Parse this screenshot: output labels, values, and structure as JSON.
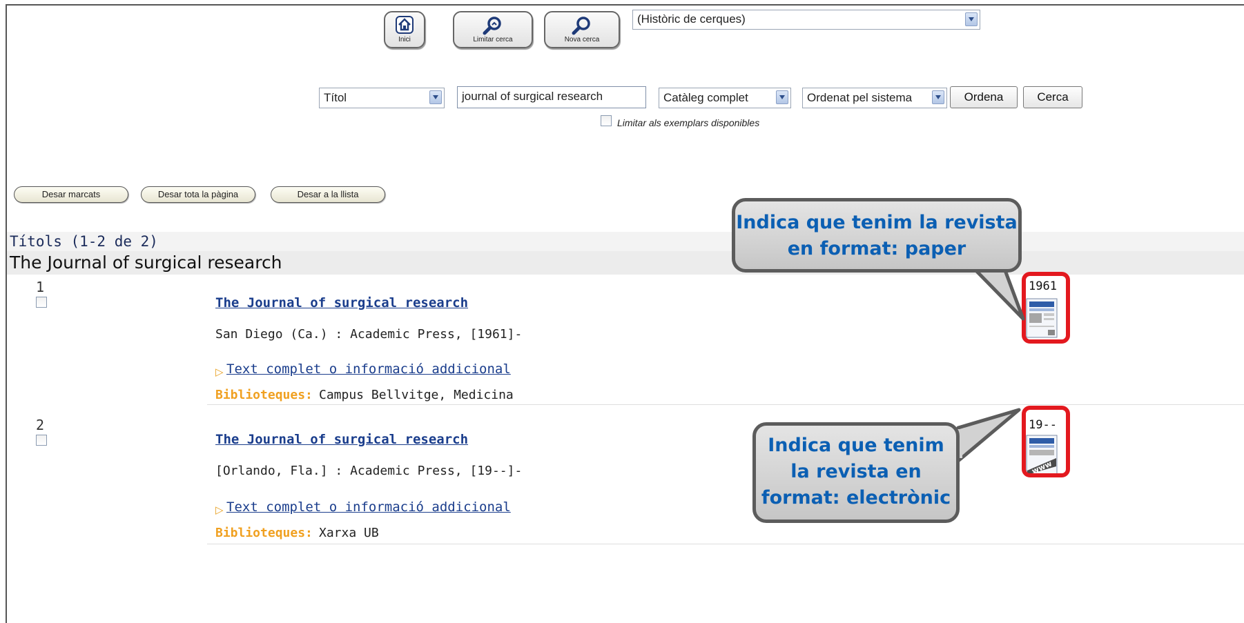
{
  "toolbar": {
    "home_label": "Inici",
    "limit_label": "Limitar cerca",
    "new_label": "Nova cerca",
    "history_select": "(Històric de cerques)"
  },
  "search": {
    "field_select": "Títol",
    "query": "journal of surgical research",
    "scope_select": "Catàleg complet",
    "sort_select": "Ordenat pel sistema",
    "sort_button": "Ordena",
    "search_button": "Cerca",
    "limit_available": "Limitar als exemplars disponibles"
  },
  "actions": {
    "save_marked": "Desar marcats",
    "save_page": "Desar tota la pàgina",
    "save_list": "Desar a la llista"
  },
  "results": {
    "count_label": "Títols (1-2 de 2)",
    "group_title": "The Journal of surgical research",
    "items": [
      {
        "num": "1",
        "title": "The Journal of surgical research",
        "publisher": "San Diego (Ca.) : Academic Press, [1961]-",
        "fulltext_link": "Text complet o informació addicional",
        "libraries_label": "Biblioteques:",
        "libraries": "Campus Bellvitge, Medicina",
        "year": "1961 -",
        "format_icon": "print-journal-icon"
      },
      {
        "num": "2",
        "title": "The Journal of surgical research",
        "publisher": "[Orlando, Fla.] : Academic Press, [19--]-",
        "fulltext_link": "Text complet o informació addicional",
        "libraries_label": "Biblioteques:",
        "libraries": "Xarxa UB",
        "year": "19-- -",
        "format_icon": "electronic-journal-icon"
      }
    ]
  },
  "callouts": {
    "paper": "Indica que tenim la revista en format: paper",
    "electronic": "Indica que tenim la revista en format: electrònic"
  },
  "colors": {
    "link": "#1a3d8c",
    "libraries_label": "#f0a020",
    "callout_text": "#0b5fb3",
    "highlight": "#e3191f"
  }
}
